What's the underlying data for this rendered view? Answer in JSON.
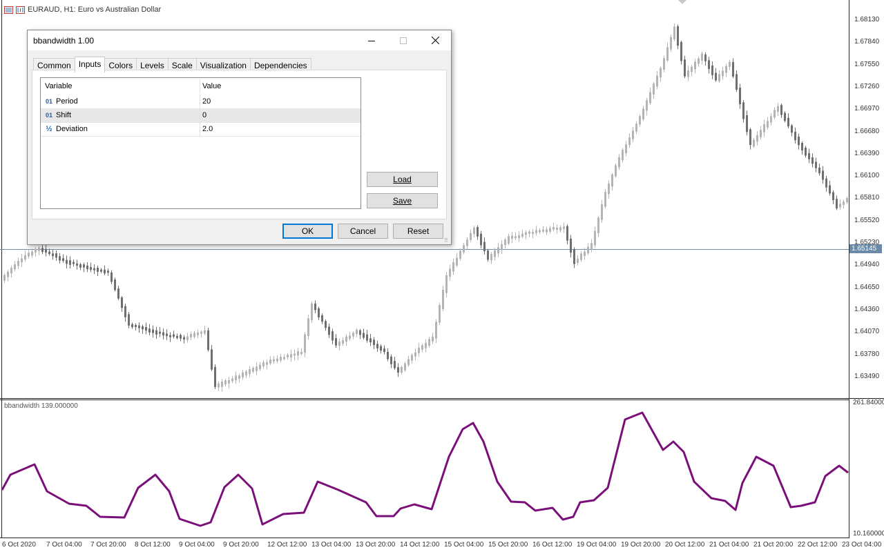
{
  "chart": {
    "title": "EURAUD, H1:  Euro vs Australian Dollar",
    "price_labels": [
      "1.68130",
      "1.67840",
      "1.67550",
      "1.67260",
      "1.66970",
      "1.66680",
      "1.66390",
      "1.66100",
      "1.65810",
      "1.65520",
      "1.65230",
      "1.64940",
      "1.64650",
      "1.64360",
      "1.64070",
      "1.63780",
      "1.63490"
    ],
    "current_price": "1.65145",
    "time_labels": [
      "6 Oct 2020",
      "7 Oct 04:00",
      "7 Oct 20:00",
      "8 Oct 12:00",
      "9 Oct 04:00",
      "9 Oct 20:00",
      "12 Oct 12:00",
      "13 Oct 04:00",
      "13 Oct 20:00",
      "14 Oct 12:00",
      "15 Oct 04:00",
      "15 Oct 20:00",
      "16 Oct 12:00",
      "19 Oct 04:00",
      "19 Oct 20:00",
      "20 Oct 12:00",
      "21 Oct 04:00",
      "21 Oct 20:00",
      "22 Oct 12:00",
      "23 Oct 04:00"
    ],
    "indicator_label": "bbandwidth 139.000000",
    "indicator_max": "261.840000",
    "indicator_min": "10.160000",
    "colors": {
      "bull": "#b4b4b4",
      "bear": "#6e6e6e",
      "indicator": "#7a0f7a",
      "price_line": "#6b8aa8"
    }
  },
  "dialog": {
    "title": "bbandwidth 1.00",
    "tabs": [
      "Common",
      "Inputs",
      "Colors",
      "Levels",
      "Scale",
      "Visualization",
      "Dependencies"
    ],
    "active_tab": "Inputs",
    "grid": {
      "headers": [
        "Variable",
        "Value"
      ],
      "rows": [
        {
          "icon": "01",
          "name": "Period",
          "value": "20"
        },
        {
          "icon": "01",
          "name": "Shift",
          "value": "0"
        },
        {
          "icon": "½",
          "name": "Deviation",
          "value": "2.0"
        }
      ]
    },
    "load_label": "Load",
    "save_label": "Save",
    "ok_label": "OK",
    "cancel_label": "Cancel",
    "reset_label": "Reset"
  }
}
